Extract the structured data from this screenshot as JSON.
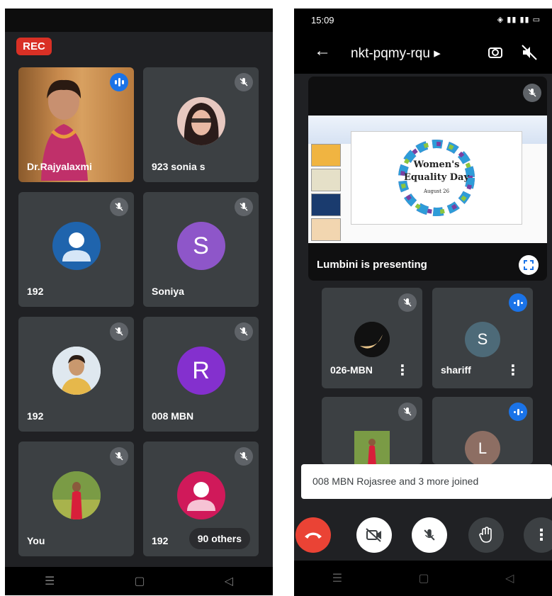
{
  "left": {
    "rec_label": "REC",
    "tiles": [
      {
        "name": "Dr.Rajyalaxmi",
        "status": "speaking"
      },
      {
        "name": "923 sonia s",
        "status": "muted"
      },
      {
        "name": "192",
        "status": "muted"
      },
      {
        "name": "Soniya",
        "status": "muted",
        "initial": "S",
        "color": "#8e56c9"
      },
      {
        "name": "192",
        "status": "muted"
      },
      {
        "name": "008 MBN",
        "status": "muted",
        "initial": "R",
        "color": "#8430ce"
      },
      {
        "name": "You",
        "status": "muted"
      },
      {
        "name": "192",
        "status": "muted"
      }
    ],
    "others_label": "90 others"
  },
  "right": {
    "status_time": "15:09",
    "meeting_code": "nkt-pqmy-rqu ▸",
    "presentation": {
      "slide_title_line1": "Women's",
      "slide_title_line2": "Equality Day",
      "slide_date": "August 26",
      "presenter_label": "Lumbini is presenting"
    },
    "tiles": [
      {
        "name": "026-MBN",
        "status": "muted"
      },
      {
        "name": "shariff",
        "status": "speaking",
        "initial": "S",
        "color": "#4d6a78"
      },
      {
        "name": "",
        "status": "muted"
      },
      {
        "name": "",
        "status": "speaking",
        "initial": "L",
        "color": "#8d6e63"
      }
    ],
    "toast": "008 MBN Rojasree and 3 more joined"
  },
  "colors": {
    "background": "#202124",
    "tile": "#3c4043",
    "rec": "#d93025",
    "accent": "#1a73e8",
    "end_call": "#ea4335"
  }
}
